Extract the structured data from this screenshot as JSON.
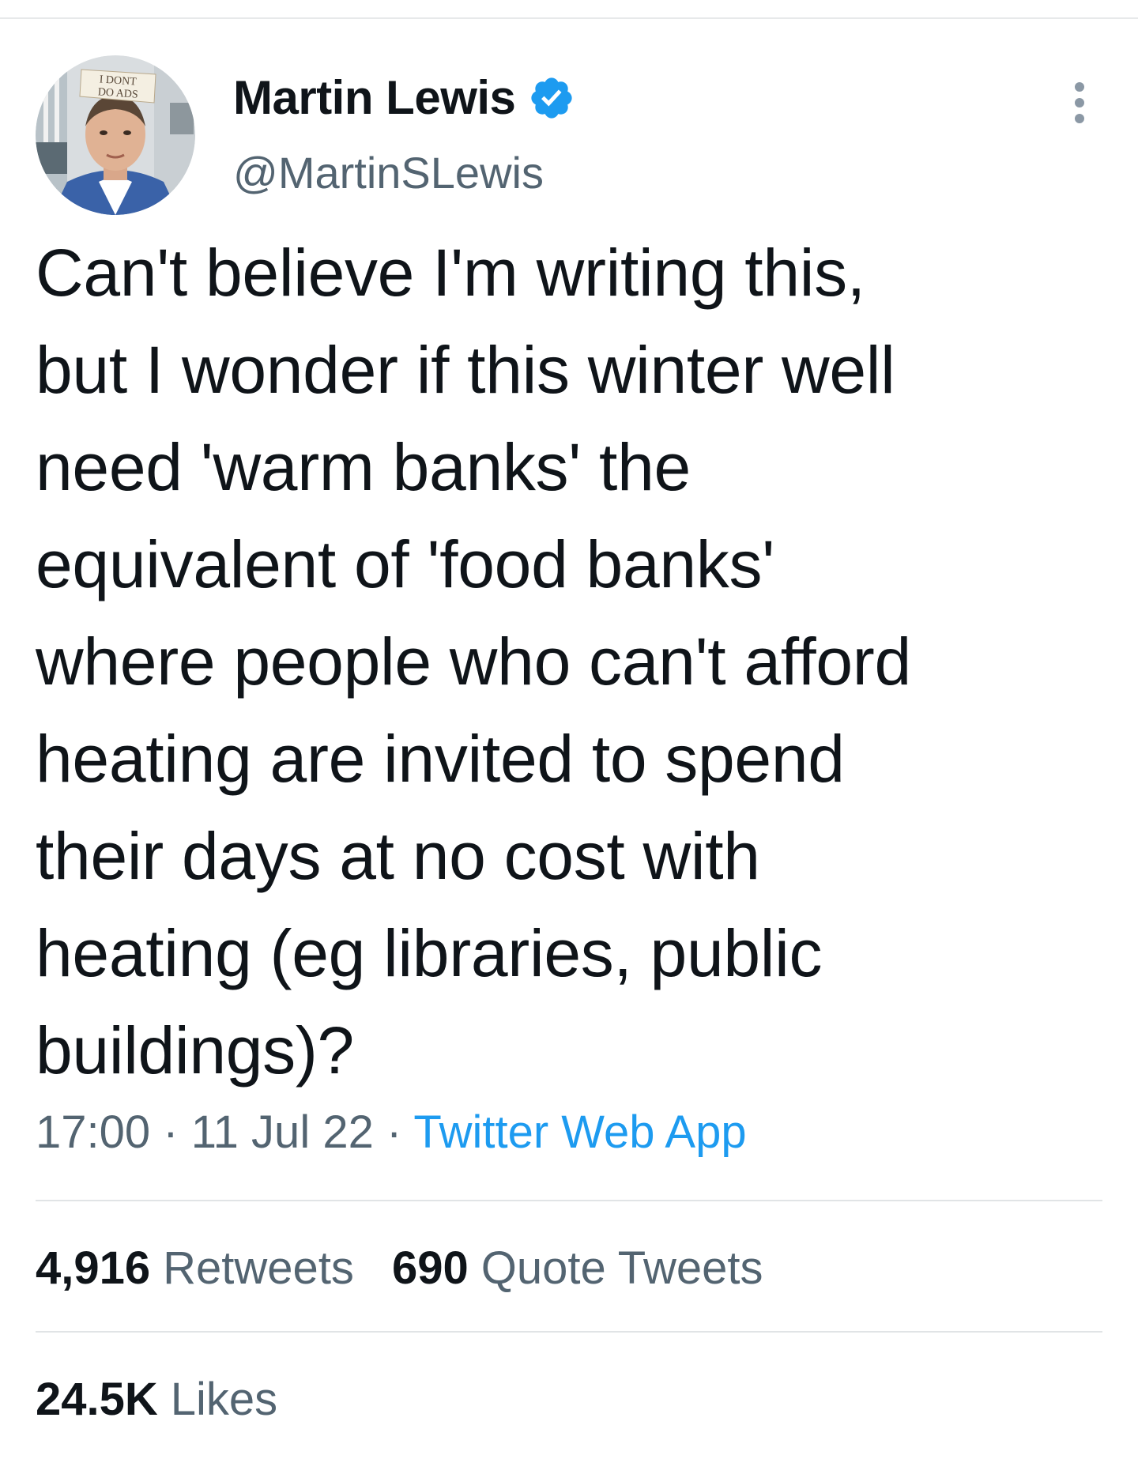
{
  "tweet": {
    "author": {
      "display_name": "Martin Lewis",
      "handle": "@MartinSLewis",
      "verified": true,
      "avatar_sign_text": [
        "I DONT",
        "DO ADS"
      ]
    },
    "text_lines": [
      "Can't believe I'm writing this,",
      "but I wonder if this winter well",
      "need 'warm banks' the",
      "equivalent of 'food banks'",
      "where people who can't afford",
      "heating are invited to spend",
      "their days at no cost with",
      "heating (eg libraries, public",
      "buildings)?"
    ],
    "time": "17:00",
    "separator": "·",
    "date": "11 Jul 22",
    "source": "Twitter Web App",
    "stats": {
      "retweets_count": "4,916",
      "retweets_label": "Retweets",
      "quotes_count": "690",
      "quotes_label": "Quote Tweets",
      "likes_count": "24.5K",
      "likes_label": "Likes"
    }
  },
  "colors": {
    "text_primary": "#0f1419",
    "text_secondary": "#536471",
    "link": "#1d9bf0",
    "verified": "#1d9bf0",
    "divider": "#e1e4e6"
  },
  "icons": {
    "verified": "verified-badge-icon",
    "more": "more-dots-vertical-icon"
  }
}
